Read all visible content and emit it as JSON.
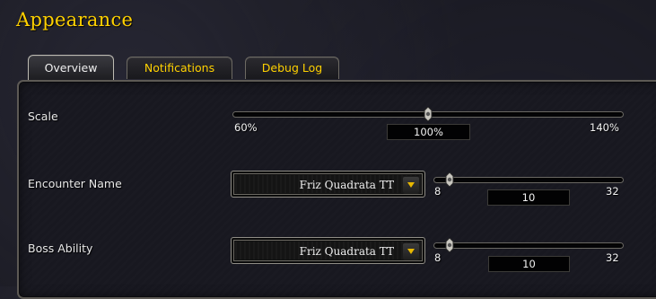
{
  "title": "Appearance",
  "tabs": [
    {
      "label": "Overview",
      "active": true
    },
    {
      "label": "Notifications",
      "active": false
    },
    {
      "label": "Debug Log",
      "active": false
    }
  ],
  "scale": {
    "label": "Scale",
    "min": "60%",
    "max": "140%",
    "value": "100%",
    "fraction": 0.5
  },
  "encounter": {
    "label": "Encounter Name",
    "font": "Friz Quadrata TT",
    "min": "8",
    "max": "32",
    "value": "10",
    "fraction": 0.083
  },
  "boss": {
    "label": "Boss Ability",
    "font": "Friz Quadrata TT",
    "min": "8",
    "max": "32",
    "value": "10",
    "fraction": 0.083
  },
  "colors": {
    "accent": "#ffd100",
    "text": "#e8e8e8"
  },
  "icons": {
    "dropdown_arrow": "chevron-down-icon",
    "slider_thumb": "slider-thumb-icon"
  }
}
